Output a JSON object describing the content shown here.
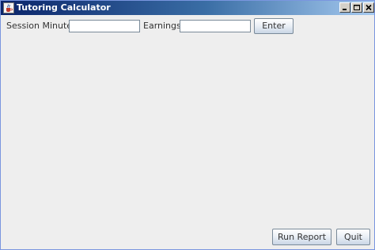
{
  "window": {
    "title": "Tutoring Calculator",
    "icon": "java-cup-icon",
    "controls": [
      "minimize",
      "maximize",
      "close"
    ]
  },
  "form": {
    "minutes_label": "Session Minutes:",
    "minutes_value": "",
    "earnings_label": "Earnings:",
    "earnings_value": "",
    "enter_label": "Enter"
  },
  "footer": {
    "report_label": "Run Report",
    "quit_label": "Quit"
  },
  "colors": {
    "titlebar_start": "#0a246a",
    "titlebar_end": "#a6caf0",
    "panel_background": "#eeeeee"
  }
}
